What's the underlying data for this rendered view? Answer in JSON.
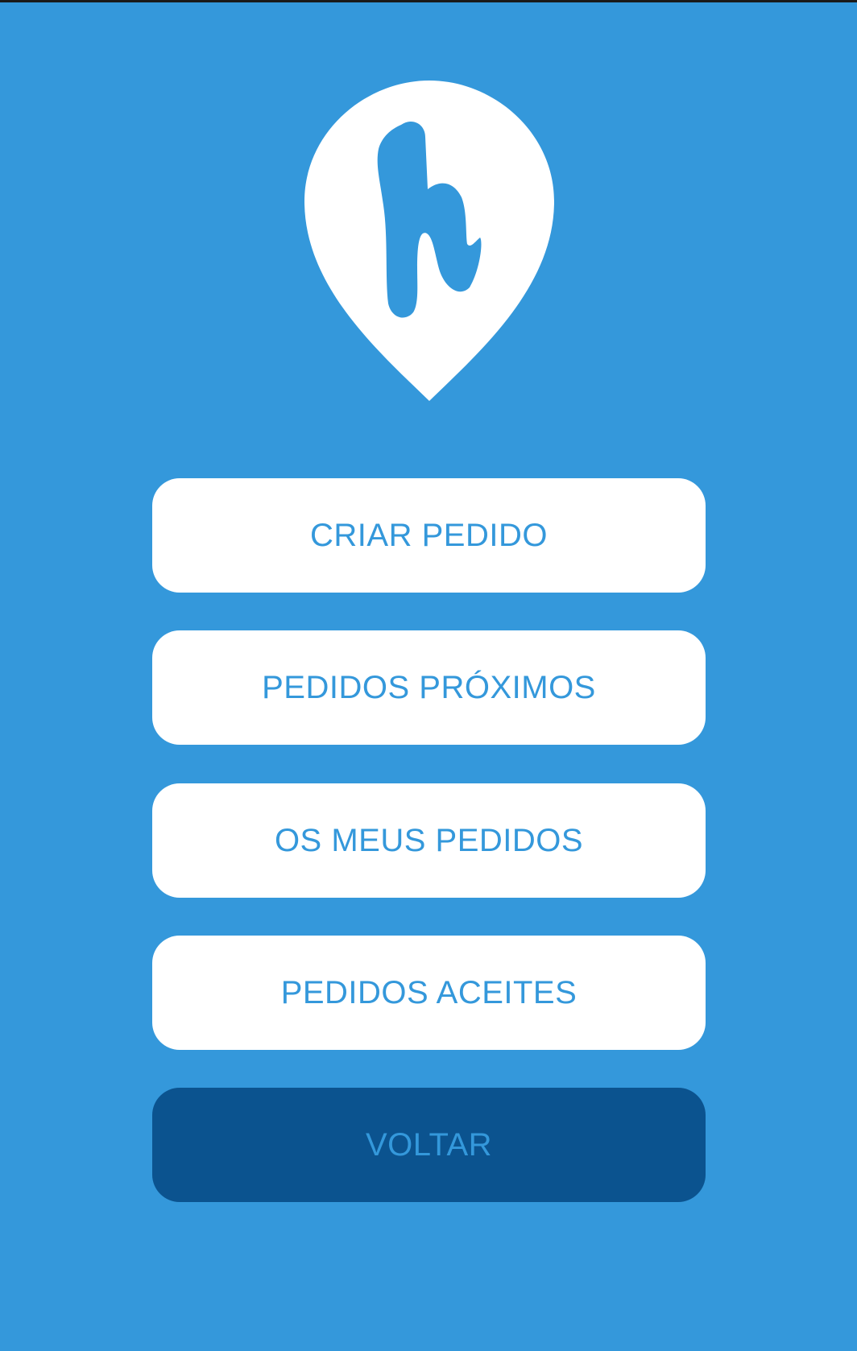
{
  "colors": {
    "background": "#3498db",
    "button_background": "#ffffff",
    "button_text": "#3498db",
    "back_button_background": "#0b538f",
    "status_strip": "#1a1a1a"
  },
  "logo": {
    "icon": "map-pin-h-logo-icon"
  },
  "menu": {
    "create_order": "CRIAR PEDIDO",
    "nearby_orders": "PEDIDOS PRÓXIMOS",
    "my_orders": "OS MEUS PEDIDOS",
    "accepted_orders": "PEDIDOS ACEITES",
    "back": "VOLTAR"
  }
}
